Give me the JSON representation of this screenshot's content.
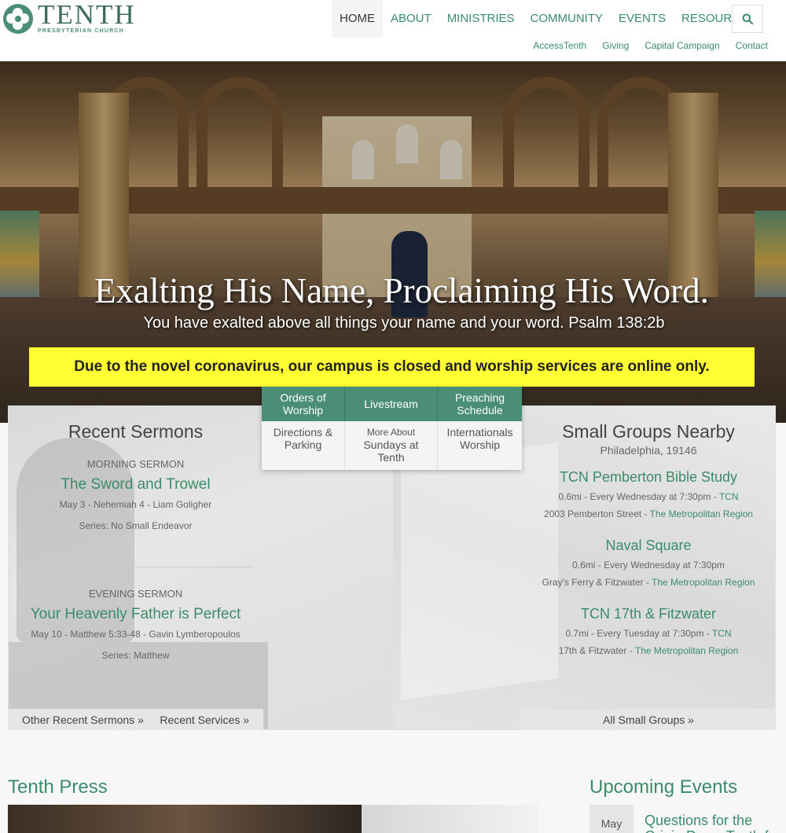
{
  "logo": {
    "name": "TENTH",
    "sub": "PRESBYTERIAN CHURCH"
  },
  "nav": {
    "main": [
      "HOME",
      "ABOUT",
      "MINISTRIES",
      "COMMUNITY",
      "EVENTS",
      "RESOURCES"
    ],
    "active": "HOME",
    "search_icon": "search-icon",
    "sub": [
      "AccessTenth",
      "Giving",
      "Capital Campaign",
      "Contact"
    ]
  },
  "hero": {
    "title": "Exalting His Name, Proclaiming His Word.",
    "subtitle": "You have exalted above all things your name and your word. Psalm 138:2b"
  },
  "alert": "Due to the novel coronavirus, our campus is closed and worship services are online only.",
  "quick_links": {
    "top": [
      "Orders of Worship",
      "Livestream",
      "Preaching Schedule"
    ],
    "bottom": [
      {
        "line1": "Directions &",
        "line2": "Parking",
        "line3": ""
      },
      {
        "line1": "More About",
        "line2": "Sundays at",
        "line3": "Tenth"
      },
      {
        "line1": "Internationals",
        "line2": "Worship",
        "line3": ""
      }
    ]
  },
  "sermons": {
    "heading": "Recent Sermons",
    "morning": {
      "label": "MORNING SERMON",
      "title": "The Sword and Trowel",
      "meta": "May 3 - Nehemiah 4 - Liam Goligher",
      "series": "Series: No Small Endeavor"
    },
    "evening": {
      "label": "EVENING SERMON",
      "title": "Your Heavenly Father is Perfect",
      "meta": "May 10 - Matthew 5:33-48 - Gavin Lymberopoulos",
      "series": "Series: Matthew"
    },
    "links": [
      "Other Recent Sermons »",
      "Recent Services »"
    ]
  },
  "groups": {
    "heading": "Small Groups Nearby",
    "location": "Philadelphia, 19146",
    "items": [
      {
        "name": "TCN Pemberton Bible Study",
        "line1": "0.6mi - Every Wednesday at 7:30pm - ",
        "line1_link": "TCN",
        "line2": "2003 Pemberton Street - ",
        "line2_link": "The Metropolitan Region"
      },
      {
        "name": "Naval Square",
        "line1": "0.6mi - Every Wednesday at 7:30pm",
        "line1_link": "",
        "line2": "Gray's Ferry & Fitzwater - ",
        "line2_link": "The Metropolitan Region"
      },
      {
        "name": "TCN 17th & Fitzwater",
        "line1": "0.7mi - Every Tuesday at 7:30pm - ",
        "line1_link": "TCN",
        "line2": "17th & Fitzwater - ",
        "line2_link": "The Metropolitan Region"
      }
    ],
    "all_link": "All Small Groups »"
  },
  "press": {
    "heading": "Tenth Press"
  },
  "events": {
    "heading": "Upcoming Events",
    "first": {
      "month": "May",
      "title": "Questions for the Origin Days: Tenth f"
    }
  }
}
